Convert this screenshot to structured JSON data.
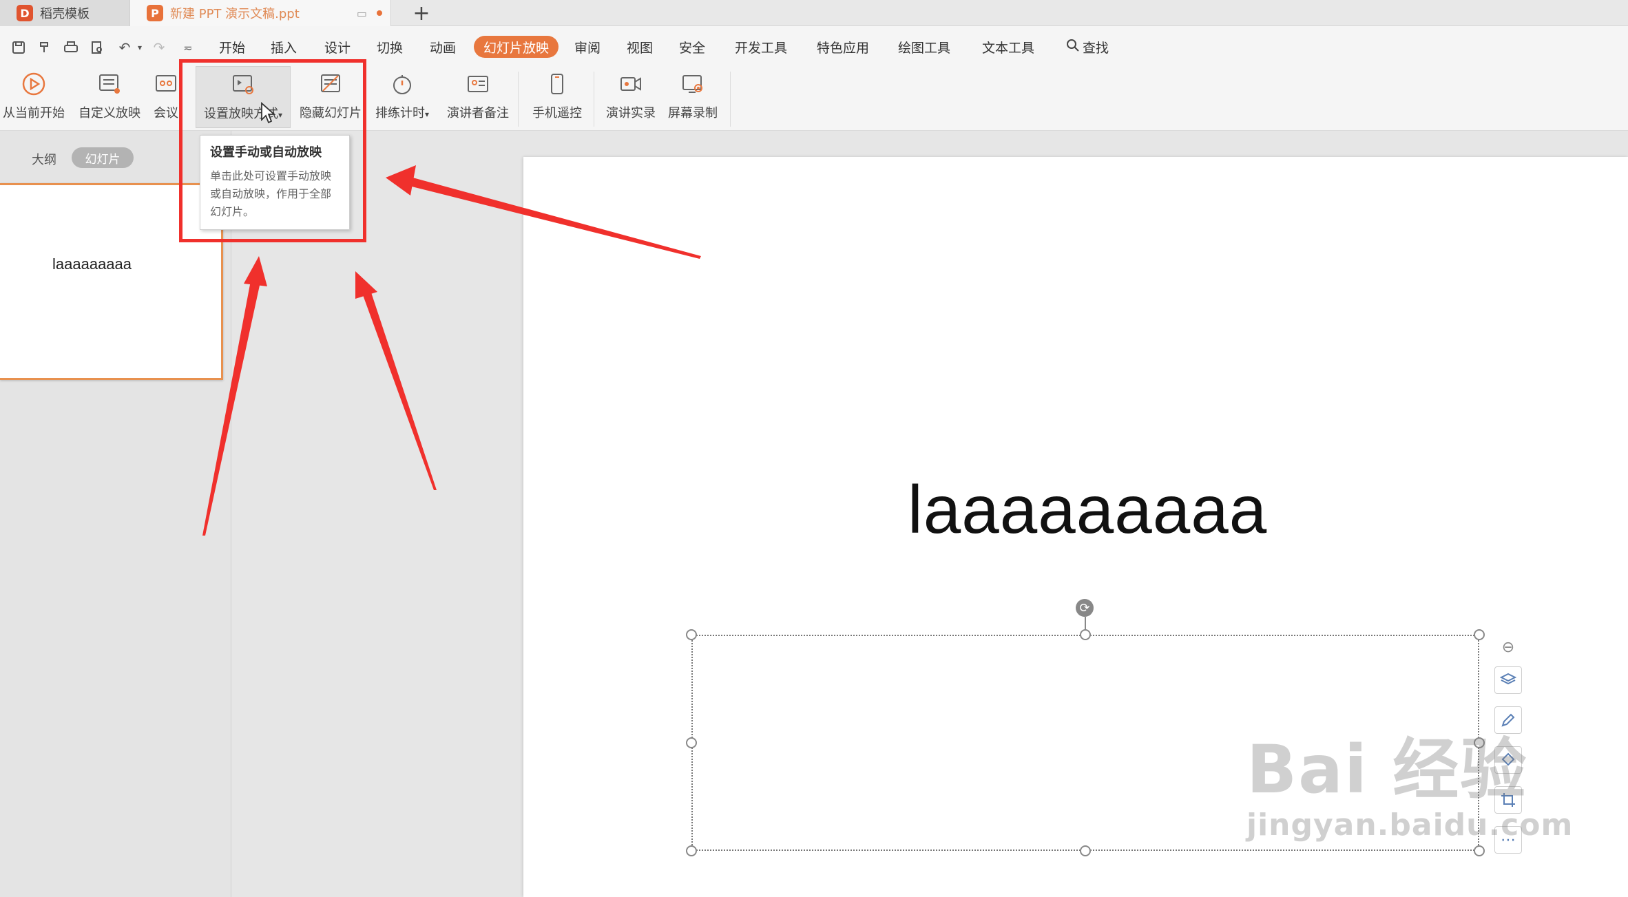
{
  "tabs": [
    {
      "label": "稻壳模板",
      "logo": "D"
    },
    {
      "label": "新建 PPT 演示文稿.ppt",
      "logo": "P"
    }
  ],
  "new_tab": "+",
  "menu": {
    "items": [
      "开始",
      "插入",
      "设计",
      "切换",
      "动画",
      "幻灯片放映",
      "审阅",
      "视图",
      "安全",
      "开发工具",
      "特色应用",
      "绘图工具",
      "文本工具"
    ],
    "search": "查找"
  },
  "ribbon": {
    "from_current": "从当前开始",
    "custom_show": "自定义放映",
    "meeting": "会议",
    "setup_show": "设置放映方式",
    "hide_slide": "隐藏幻灯片",
    "rehearse": "排练计时",
    "presenter_notes": "演讲者备注",
    "phone_remote": "手机遥控",
    "record": "演讲实录",
    "screen_record": "屏幕录制"
  },
  "tooltip": {
    "title": "设置手动或自动放映",
    "body": "单击此处可设置手动放映或自动放映，作用于全部幻灯片。"
  },
  "left_panel": {
    "outline_tab": "大纲",
    "slides_tab": "幻灯片",
    "thumb_title": "laaaaaaaaa"
  },
  "slide": {
    "title": "laaaaaaaaa"
  },
  "watermark": {
    "line1": "Bai 经验",
    "line2": "jingyan.baidu.com"
  },
  "colors": {
    "accent": "#e8773e",
    "highlight": "#f0302c"
  }
}
